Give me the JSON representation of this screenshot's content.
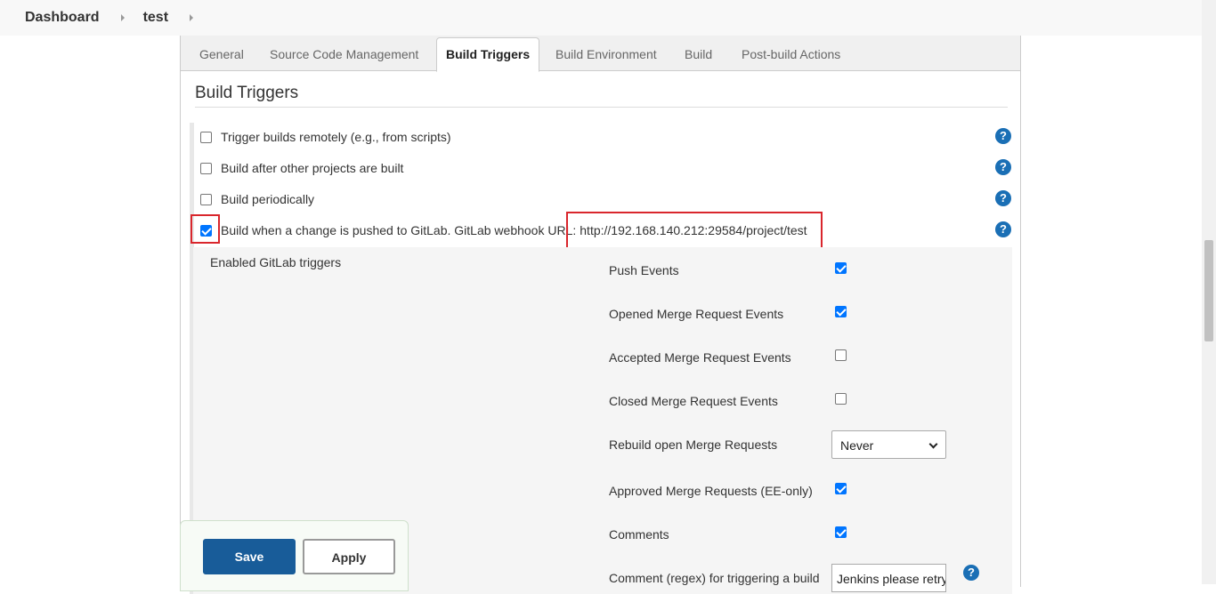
{
  "breadcrumb": {
    "items": [
      "Dashboard",
      "test"
    ]
  },
  "tabs": [
    {
      "label": "General"
    },
    {
      "label": "Source Code Management"
    },
    {
      "label": "Build Triggers"
    },
    {
      "label": "Build Environment"
    },
    {
      "label": "Build"
    },
    {
      "label": "Post-build Actions"
    }
  ],
  "active_tab": "Build Triggers",
  "section": {
    "title": "Build Triggers"
  },
  "triggers": [
    {
      "label": "Trigger builds remotely (e.g., from scripts)",
      "checked": false
    },
    {
      "label": "Build after other projects are built",
      "checked": false
    },
    {
      "label": "Build periodically",
      "checked": false
    },
    {
      "label": "Build when a change is pushed to GitLab. GitLab webhook URL:",
      "checked": true
    }
  ],
  "webhook_url": "http://192.168.140.212:29584/project/test",
  "gitlab": {
    "title": "Enabled GitLab triggers",
    "events": [
      {
        "label": "Push Events",
        "checked": true
      },
      {
        "label": "Opened Merge Request Events",
        "checked": true
      },
      {
        "label": "Accepted Merge Request Events",
        "checked": false
      },
      {
        "label": "Closed Merge Request Events",
        "checked": false
      },
      {
        "label": "Rebuild open Merge Requests",
        "select": "Never"
      },
      {
        "label": "Approved Merge Requests (EE-only)",
        "checked": true
      },
      {
        "label": "Comments",
        "checked": true
      },
      {
        "label": "Comment (regex) for triggering a build",
        "input": "Jenkins please retry"
      }
    ]
  },
  "buttons": {
    "save": "Save",
    "apply": "Apply"
  },
  "help_icon": "?",
  "colors": {
    "save_button": "#185c99",
    "highlight": "#d9262c",
    "checkbox_checked": "#0075ff",
    "help_icon": "#1a6fb5"
  }
}
